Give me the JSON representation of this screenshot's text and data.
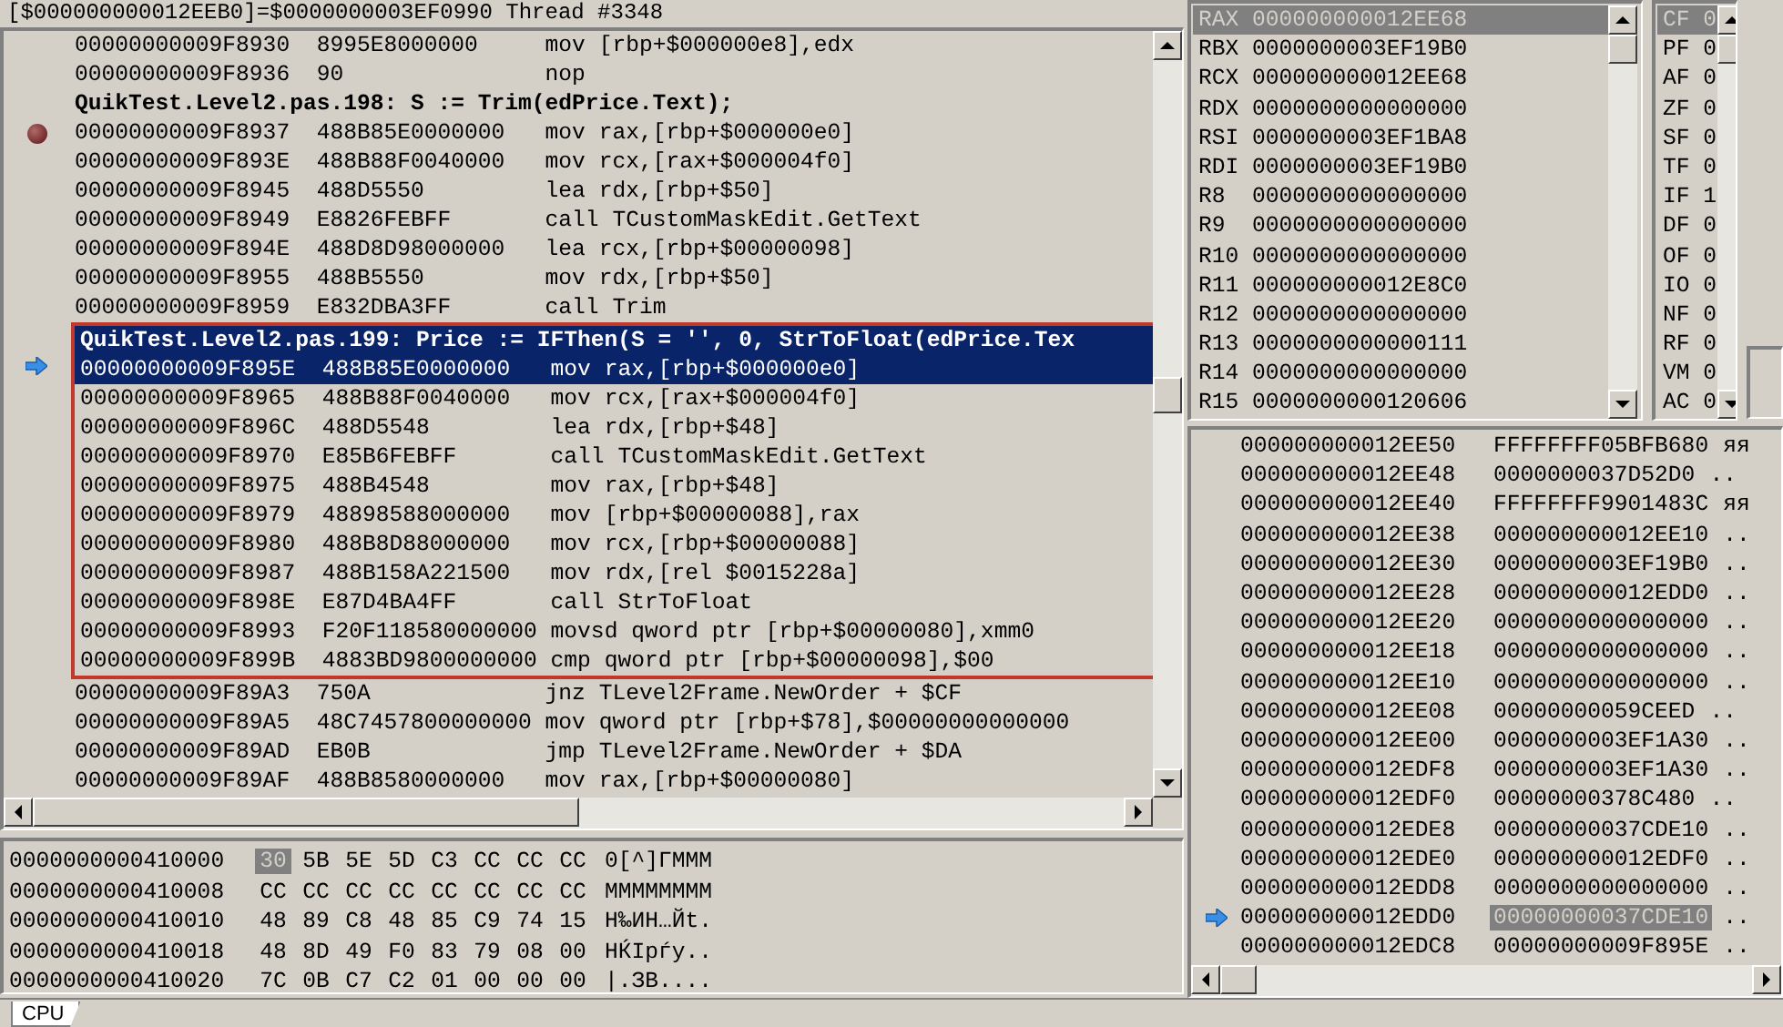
{
  "header": "[$000000000012EEB0]=$0000000003EF0990 Thread #3348",
  "disassembly": {
    "rows": [
      {
        "kind": "instr",
        "address": "00000000009F8930",
        "bytes": "8995E8000000",
        "instruction": "mov [rbp+$000000e8],edx",
        "breakpoint": false,
        "current": false,
        "selected": false,
        "boxed": false
      },
      {
        "kind": "instr",
        "address": "00000000009F8936",
        "bytes": "90",
        "instruction": "nop",
        "breakpoint": false,
        "current": false,
        "selected": false,
        "boxed": false
      },
      {
        "kind": "source",
        "text": "QuikTest.Level2.pas.198: S := Trim(edPrice.Text);",
        "selected": false,
        "boxed": false
      },
      {
        "kind": "instr",
        "address": "00000000009F8937",
        "bytes": "488B85E0000000",
        "instruction": "mov rax,[rbp+$000000e0]",
        "breakpoint": true,
        "current": false,
        "selected": false,
        "boxed": false
      },
      {
        "kind": "instr",
        "address": "00000000009F893E",
        "bytes": "488B88F0040000",
        "instruction": "mov rcx,[rax+$000004f0]",
        "breakpoint": false,
        "current": false,
        "selected": false,
        "boxed": false
      },
      {
        "kind": "instr",
        "address": "00000000009F8945",
        "bytes": "488D5550",
        "instruction": "lea rdx,[rbp+$50]",
        "breakpoint": false,
        "current": false,
        "selected": false,
        "boxed": false
      },
      {
        "kind": "instr",
        "address": "00000000009F8949",
        "bytes": "E8826FEBFF",
        "instruction": "call TCustomMaskEdit.GetText",
        "breakpoint": false,
        "current": false,
        "selected": false,
        "boxed": false
      },
      {
        "kind": "instr",
        "address": "00000000009F894E",
        "bytes": "488D8D98000000",
        "instruction": "lea rcx,[rbp+$00000098]",
        "breakpoint": false,
        "current": false,
        "selected": false,
        "boxed": false
      },
      {
        "kind": "instr",
        "address": "00000000009F8955",
        "bytes": "488B5550",
        "instruction": "mov rdx,[rbp+$50]",
        "breakpoint": false,
        "current": false,
        "selected": false,
        "boxed": false
      },
      {
        "kind": "instr",
        "address": "00000000009F8959",
        "bytes": "E832DBA3FF",
        "instruction": "call Trim",
        "breakpoint": false,
        "current": false,
        "selected": false,
        "boxed": false
      },
      {
        "kind": "source",
        "text": "QuikTest.Level2.pas.199: Price := IFThen(S = '', 0, StrToFloat(edPrice.Tex",
        "selected": true,
        "boxed": true
      },
      {
        "kind": "instr",
        "address": "00000000009F895E",
        "bytes": "488B85E0000000",
        "instruction": "mov rax,[rbp+$000000e0]",
        "breakpoint": false,
        "current": true,
        "selected": true,
        "boxed": true
      },
      {
        "kind": "instr",
        "address": "00000000009F8965",
        "bytes": "488B88F0040000",
        "instruction": "mov rcx,[rax+$000004f0]",
        "breakpoint": false,
        "current": false,
        "selected": false,
        "boxed": true
      },
      {
        "kind": "instr",
        "address": "00000000009F896C",
        "bytes": "488D5548",
        "instruction": "lea rdx,[rbp+$48]",
        "breakpoint": false,
        "current": false,
        "selected": false,
        "boxed": true
      },
      {
        "kind": "instr",
        "address": "00000000009F8970",
        "bytes": "E85B6FEBFF",
        "instruction": "call TCustomMaskEdit.GetText",
        "breakpoint": false,
        "current": false,
        "selected": false,
        "boxed": true
      },
      {
        "kind": "instr",
        "address": "00000000009F8975",
        "bytes": "488B4548",
        "instruction": "mov rax,[rbp+$48]",
        "breakpoint": false,
        "current": false,
        "selected": false,
        "boxed": true
      },
      {
        "kind": "instr",
        "address": "00000000009F8979",
        "bytes": "48898588000000",
        "instruction": "mov [rbp+$00000088],rax",
        "breakpoint": false,
        "current": false,
        "selected": false,
        "boxed": true
      },
      {
        "kind": "instr",
        "address": "00000000009F8980",
        "bytes": "488B8D88000000",
        "instruction": "mov rcx,[rbp+$00000088]",
        "breakpoint": false,
        "current": false,
        "selected": false,
        "boxed": true
      },
      {
        "kind": "instr",
        "address": "00000000009F8987",
        "bytes": "488B158A221500",
        "instruction": "mov rdx,[rel $0015228a]",
        "breakpoint": false,
        "current": false,
        "selected": false,
        "boxed": true
      },
      {
        "kind": "instr",
        "address": "00000000009F898E",
        "bytes": "E87D4BA4FF",
        "instruction": "call StrToFloat",
        "breakpoint": false,
        "current": false,
        "selected": false,
        "boxed": true
      },
      {
        "kind": "instr",
        "address": "00000000009F8993",
        "bytes": "F20F118580000000",
        "instruction": "movsd qword ptr [rbp+$00000080],xmm0",
        "breakpoint": false,
        "current": false,
        "selected": false,
        "boxed": true
      },
      {
        "kind": "instr",
        "address": "00000000009F899B",
        "bytes": "4883BD9800000000",
        "instruction": "cmp qword ptr [rbp+$00000098],$00",
        "breakpoint": false,
        "current": false,
        "selected": false,
        "boxed": true
      },
      {
        "kind": "instr",
        "address": "00000000009F89A3",
        "bytes": "750A",
        "instruction": "jnz TLevel2Frame.NewOrder + $CF",
        "breakpoint": false,
        "current": false,
        "selected": false,
        "boxed": false
      },
      {
        "kind": "instr",
        "address": "00000000009F89A5",
        "bytes": "48C7457800000000",
        "instruction": "mov qword ptr [rbp+$78],$00000000000000",
        "breakpoint": false,
        "current": false,
        "selected": false,
        "boxed": false
      },
      {
        "kind": "instr",
        "address": "00000000009F89AD",
        "bytes": "EB0B",
        "instruction": "jmp TLevel2Frame.NewOrder + $DA",
        "breakpoint": false,
        "current": false,
        "selected": false,
        "boxed": false
      },
      {
        "kind": "instr",
        "address": "00000000009F89AF",
        "bytes": "488B8580000000",
        "instruction": "mov rax,[rbp+$00000080]",
        "breakpoint": false,
        "current": false,
        "selected": false,
        "boxed": false
      }
    ]
  },
  "registers": [
    {
      "name": "RAX",
      "value": "000000000012EE68",
      "selected": true
    },
    {
      "name": "RBX",
      "value": "0000000003EF19B0",
      "selected": false
    },
    {
      "name": "RCX",
      "value": "000000000012EE68",
      "selected": false
    },
    {
      "name": "RDX",
      "value": "0000000000000000",
      "selected": false
    },
    {
      "name": "RSI",
      "value": "0000000003EF1BA8",
      "selected": false
    },
    {
      "name": "RDI",
      "value": "0000000003EF19B0",
      "selected": false
    },
    {
      "name": "R8",
      "value": "0000000000000000",
      "selected": false
    },
    {
      "name": "R9",
      "value": "0000000000000000",
      "selected": false
    },
    {
      "name": "R10",
      "value": "0000000000000000",
      "selected": false
    },
    {
      "name": "R11",
      "value": "000000000012E8C0",
      "selected": false
    },
    {
      "name": "R12",
      "value": "0000000000000000",
      "selected": false
    },
    {
      "name": "R13",
      "value": "0000000000000111",
      "selected": false
    },
    {
      "name": "R14",
      "value": "0000000000000000",
      "selected": false
    },
    {
      "name": "R15",
      "value": "0000000000120606",
      "selected": false
    }
  ],
  "flags": [
    {
      "name": "CF",
      "value": "0",
      "selected": true
    },
    {
      "name": "PF",
      "value": "0",
      "selected": false
    },
    {
      "name": "AF",
      "value": "0",
      "selected": false
    },
    {
      "name": "ZF",
      "value": "0",
      "selected": false
    },
    {
      "name": "SF",
      "value": "0",
      "selected": false
    },
    {
      "name": "TF",
      "value": "0",
      "selected": false
    },
    {
      "name": "IF",
      "value": "1",
      "selected": false
    },
    {
      "name": "DF",
      "value": "0",
      "selected": false
    },
    {
      "name": "OF",
      "value": "0",
      "selected": false
    },
    {
      "name": "IO",
      "value": "0",
      "selected": false
    },
    {
      "name": "NF",
      "value": "0",
      "selected": false
    },
    {
      "name": "RF",
      "value": "0",
      "selected": false
    },
    {
      "name": "VM",
      "value": "0",
      "selected": false
    },
    {
      "name": "AC",
      "value": "0",
      "selected": false
    }
  ],
  "stack": [
    {
      "address": "000000000012EE50",
      "value": "FFFFFFFF05BFB680",
      "chars": "яя",
      "current": false,
      "selected": false
    },
    {
      "address": "000000000012EE48",
      "value": "0000000037D52D0",
      "chars": "..",
      "current": false,
      "selected": false
    },
    {
      "address": "000000000012EE40",
      "value": "FFFFFFFF9901483C",
      "chars": "яя",
      "current": false,
      "selected": false
    },
    {
      "address": "000000000012EE38",
      "value": "000000000012EE10",
      "chars": "..",
      "current": false,
      "selected": false
    },
    {
      "address": "000000000012EE30",
      "value": "0000000003EF19B0",
      "chars": "..",
      "current": false,
      "selected": false
    },
    {
      "address": "000000000012EE28",
      "value": "000000000012EDD0",
      "chars": "..",
      "current": false,
      "selected": false
    },
    {
      "address": "000000000012EE20",
      "value": "0000000000000000",
      "chars": "..",
      "current": false,
      "selected": false
    },
    {
      "address": "000000000012EE18",
      "value": "0000000000000000",
      "chars": "..",
      "current": false,
      "selected": false
    },
    {
      "address": "000000000012EE10",
      "value": "0000000000000000",
      "chars": "..",
      "current": false,
      "selected": false
    },
    {
      "address": "000000000012EE08",
      "value": "00000000059CEED",
      "chars": "..",
      "current": false,
      "selected": false
    },
    {
      "address": "000000000012EE00",
      "value": "0000000003EF1A30",
      "chars": "..",
      "current": false,
      "selected": false
    },
    {
      "address": "000000000012EDF8",
      "value": "0000000003EF1A30",
      "chars": "..",
      "current": false,
      "selected": false
    },
    {
      "address": "000000000012EDF0",
      "value": "00000000378C480",
      "chars": "..",
      "current": false,
      "selected": false
    },
    {
      "address": "000000000012EDE8",
      "value": "00000000037CDE10",
      "chars": "..",
      "current": false,
      "selected": false
    },
    {
      "address": "000000000012EDE0",
      "value": "000000000012EDF0",
      "chars": "..",
      "current": false,
      "selected": false
    },
    {
      "address": "000000000012EDD8",
      "value": "0000000000000000",
      "chars": "..",
      "current": false,
      "selected": false
    },
    {
      "address": "000000000012EDD0",
      "value": "00000000037CDE10",
      "chars": "..",
      "current": true,
      "selected": true
    },
    {
      "address": "000000000012EDC8",
      "value": "00000000009F895E",
      "chars": "..",
      "current": false,
      "selected": false
    }
  ],
  "memory": [
    {
      "address": "0000000000410000",
      "bytes": [
        {
          "text": "30",
          "selected": true
        },
        {
          "text": "5B",
          "selected": false
        },
        {
          "text": "5E",
          "selected": false
        },
        {
          "text": "5D",
          "selected": false
        },
        {
          "text": "C3",
          "selected": false
        },
        {
          "text": "CC",
          "selected": false
        },
        {
          "text": "CC",
          "selected": false
        },
        {
          "text": "CC",
          "selected": false
        }
      ],
      "chars": "0[^]ГМММ"
    },
    {
      "address": "0000000000410008",
      "bytes": [
        {
          "text": "CC",
          "selected": false
        },
        {
          "text": "CC",
          "selected": false
        },
        {
          "text": "CC",
          "selected": false
        },
        {
          "text": "CC",
          "selected": false
        },
        {
          "text": "CC",
          "selected": false
        },
        {
          "text": "CC",
          "selected": false
        },
        {
          "text": "CC",
          "selected": false
        },
        {
          "text": "CC",
          "selected": false
        }
      ],
      "chars": "ММММММММ"
    },
    {
      "address": "0000000000410010",
      "bytes": [
        {
          "text": "48",
          "selected": false
        },
        {
          "text": "89",
          "selected": false
        },
        {
          "text": "C8",
          "selected": false
        },
        {
          "text": "48",
          "selected": false
        },
        {
          "text": "85",
          "selected": false
        },
        {
          "text": "C9",
          "selected": false
        },
        {
          "text": "74",
          "selected": false
        },
        {
          "text": "15",
          "selected": false
        }
      ],
      "chars": "H‰ИH…Йt."
    },
    {
      "address": "0000000000410018",
      "bytes": [
        {
          "text": "48",
          "selected": false
        },
        {
          "text": "8D",
          "selected": false
        },
        {
          "text": "49",
          "selected": false
        },
        {
          "text": "F0",
          "selected": false
        },
        {
          "text": "83",
          "selected": false
        },
        {
          "text": "79",
          "selected": false
        },
        {
          "text": "08",
          "selected": false
        },
        {
          "text": "00",
          "selected": false
        }
      ],
      "chars": "HЌIрѓy.."
    },
    {
      "address": "0000000000410020",
      "bytes": [
        {
          "text": "7C",
          "selected": false
        },
        {
          "text": "0B",
          "selected": false
        },
        {
          "text": "C7",
          "selected": false
        },
        {
          "text": "C2",
          "selected": false
        },
        {
          "text": "01",
          "selected": false
        },
        {
          "text": "00",
          "selected": false
        },
        {
          "text": "00",
          "selected": false
        },
        {
          "text": "00",
          "selected": false
        }
      ],
      "chars": "|.ЗВ...."
    }
  ],
  "tabs": [
    {
      "label": "CPU",
      "selected": true
    }
  ]
}
